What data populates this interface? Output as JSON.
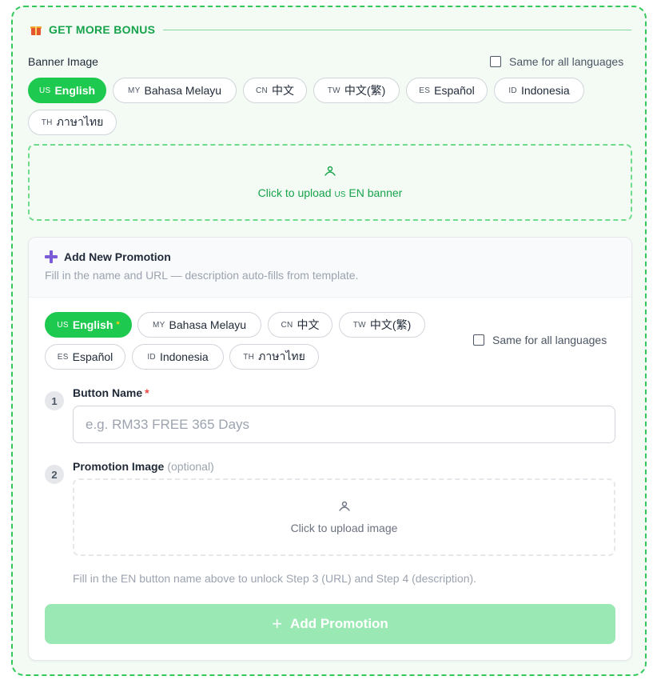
{
  "section": {
    "title": "GET MORE BONUS",
    "icon": "gift-icon"
  },
  "banner": {
    "label": "Banner Image",
    "same_all_label": "Same for all languages",
    "languages": [
      {
        "code": "US",
        "name": "English"
      },
      {
        "code": "MY",
        "name": "Bahasa Melayu"
      },
      {
        "code": "CN",
        "name": "中文"
      },
      {
        "code": "TW",
        "name": "中文(繁)"
      },
      {
        "code": "ES",
        "name": "Español"
      },
      {
        "code": "ID",
        "name": "Indonesia"
      },
      {
        "code": "TH",
        "name": "ภาษาไทย"
      }
    ],
    "active_index": 0,
    "upload_prefix": "Click to upload",
    "upload_code": "US",
    "upload_suffix": "EN banner"
  },
  "promotion": {
    "title": "Add New Promotion",
    "subtitle": "Fill in the name and URL — description auto-fills from template.",
    "same_all_label": "Same for all languages",
    "languages": [
      {
        "code": "US",
        "name": "English",
        "star": "*"
      },
      {
        "code": "MY",
        "name": "Bahasa Melayu"
      },
      {
        "code": "CN",
        "name": "中文"
      },
      {
        "code": "TW",
        "name": "中文(繁)"
      },
      {
        "code": "ES",
        "name": "Español"
      },
      {
        "code": "ID",
        "name": "Indonesia"
      },
      {
        "code": "TH",
        "name": "ภาษาไทย"
      }
    ],
    "step1": {
      "num": "1",
      "label": "Button Name",
      "required_mark": "*",
      "placeholder": "e.g. RM33 FREE 365 Days",
      "value": ""
    },
    "step2": {
      "num": "2",
      "label": "Promotion Image",
      "optional": "(optional)",
      "upload_text": "Click to upload image"
    },
    "hint": "Fill in the EN button name above to unlock Step 3 (URL) and Step 4 (description).",
    "add_button": {
      "icon": "+",
      "label": "Add Promotion"
    }
  },
  "colors": {
    "accent": "#1ec94f",
    "section_title": "#16a34a",
    "required": "#ef4444",
    "button_disabled": "#9ae8b3"
  }
}
